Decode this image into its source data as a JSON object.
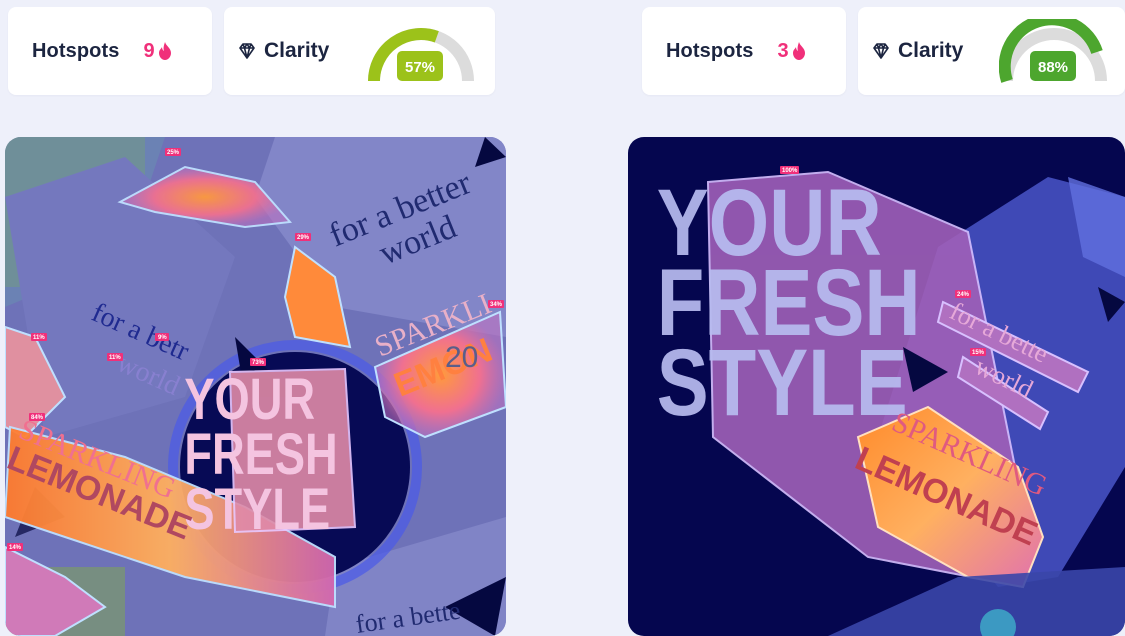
{
  "left": {
    "hotspots": {
      "label": "Hotspots",
      "count": "9"
    },
    "clarity": {
      "label": "Clarity",
      "value_text": "57%",
      "value": 0.57,
      "color": "#9cc21a"
    },
    "image": {
      "text_top": "for a better",
      "text_top2": "world",
      "headline": [
        "YOUR",
        "FRESH",
        "STYLE"
      ],
      "sparkling": "SPARKLING",
      "lemonade": "LEMONADE",
      "lemon_partial": "EMON",
      "sparkling_partial": "SPARKLI",
      "small_text": "for a betr",
      "small_text2": "world",
      "bottom_text": "for a bette",
      "overlay_number": "20",
      "tags": [
        "25%",
        "29%",
        "34%",
        "11%",
        "9%",
        "11%",
        "73%",
        "84%",
        "14%"
      ]
    }
  },
  "right": {
    "hotspots": {
      "label": "Hotspots",
      "count": "3"
    },
    "clarity": {
      "label": "Clarity",
      "value_text": "88%",
      "value": 0.88,
      "color": "#4da62e"
    },
    "image": {
      "headline": [
        "YOUR",
        "FRESH",
        "STYLE"
      ],
      "small_text": "for a bette",
      "small_text2": "world",
      "sparkling": "SPARKLING",
      "lemonade": "LEMONADE",
      "tags": [
        "100%",
        "24%",
        "15%"
      ]
    }
  },
  "colors": {
    "accent": "#f0307a",
    "text": "#1c2540",
    "panel_left": "#6e72b8",
    "panel_right": "#05064f"
  }
}
